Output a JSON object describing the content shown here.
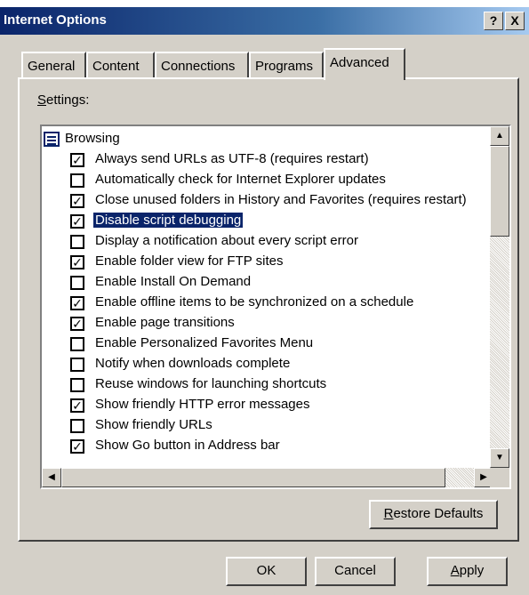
{
  "window": {
    "title": "Internet Options",
    "help_label": "?",
    "close_label": "X"
  },
  "tabs": [
    {
      "label": "General",
      "active": false
    },
    {
      "label": "Content",
      "active": false
    },
    {
      "label": "Connections",
      "active": false
    },
    {
      "label": "Programs",
      "active": false
    },
    {
      "label": "Advanced",
      "active": true
    }
  ],
  "settings": {
    "label_mnemonic": "S",
    "label_rest": "ettings:",
    "group": {
      "icon": "settings-list-icon",
      "label": "Browsing"
    },
    "items": [
      {
        "label": "Always send URLs as UTF-8 (requires restart)",
        "checked": true,
        "selected": false
      },
      {
        "label": "Automatically check for Internet Explorer updates",
        "checked": false,
        "selected": false
      },
      {
        "label": "Close unused folders in History and Favorites (requires restart)",
        "checked": true,
        "selected": false
      },
      {
        "label": "Disable script debugging",
        "checked": true,
        "selected": true
      },
      {
        "label": "Display a notification about every script error",
        "checked": false,
        "selected": false
      },
      {
        "label": "Enable folder view for FTP sites",
        "checked": true,
        "selected": false
      },
      {
        "label": "Enable Install On Demand",
        "checked": false,
        "selected": false
      },
      {
        "label": "Enable offline items to be synchronized on a schedule",
        "checked": true,
        "selected": false
      },
      {
        "label": "Enable page transitions",
        "checked": true,
        "selected": false
      },
      {
        "label": "Enable Personalized Favorites Menu",
        "checked": false,
        "selected": false
      },
      {
        "label": "Notify when downloads complete",
        "checked": false,
        "selected": false
      },
      {
        "label": "Reuse windows for launching shortcuts",
        "checked": false,
        "selected": false
      },
      {
        "label": "Show friendly HTTP error messages",
        "checked": true,
        "selected": false
      },
      {
        "label": "Show friendly URLs",
        "checked": false,
        "selected": false
      },
      {
        "label": "Show Go button in Address bar",
        "checked": true,
        "selected": false
      }
    ]
  },
  "buttons": {
    "restore_mnemonic": "R",
    "restore_rest": "estore Defaults",
    "ok": "OK",
    "cancel": "Cancel",
    "apply_mnemonic": "A",
    "apply_rest": "pply"
  },
  "icons": {
    "scroll_up": "▲",
    "scroll_down": "▼",
    "scroll_left": "◀",
    "scroll_right": "▶",
    "check": "✓"
  },
  "colors": {
    "face": "#d4d0c8",
    "selection": "#0a246a",
    "title_start": "#0a246a",
    "title_end": "#a6caf0"
  }
}
